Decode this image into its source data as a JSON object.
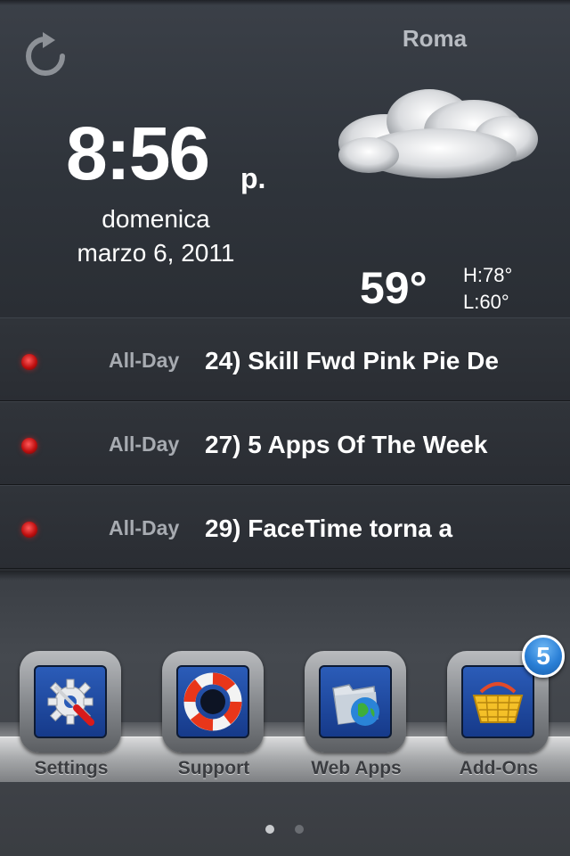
{
  "weather": {
    "city": "Roma",
    "time": "8:56",
    "ampm": "p.",
    "day": "domenica",
    "date": "marzo 6, 2011",
    "temperature": "59°",
    "high": "H:78°",
    "low": "L:60°",
    "condition_icon": "cloud-icon",
    "refresh_icon": "refresh-icon"
  },
  "events": [
    {
      "label": "All-Day",
      "title": "24) Skill Fwd Pink Pie De"
    },
    {
      "label": "All-Day",
      "title": "27) 5 Apps Of The Week"
    },
    {
      "label": "All-Day",
      "title": "29) FaceTime torna a"
    }
  ],
  "dock": {
    "apps": [
      {
        "label": "Settings",
        "icon": "settings-gear-screwdriver-icon"
      },
      {
        "label": "Support",
        "icon": "life-buoy-icon"
      },
      {
        "label": "Web Apps",
        "icon": "folder-globe-icon"
      },
      {
        "label": "Add-Ons",
        "icon": "shopping-basket-icon"
      }
    ],
    "badge_count": "5"
  },
  "pager": {
    "pages": 2,
    "current": 1
  },
  "colors": {
    "badge": "#2a7fd6",
    "event_dot": "#d01515",
    "app_tile": "#1e4aa0"
  }
}
